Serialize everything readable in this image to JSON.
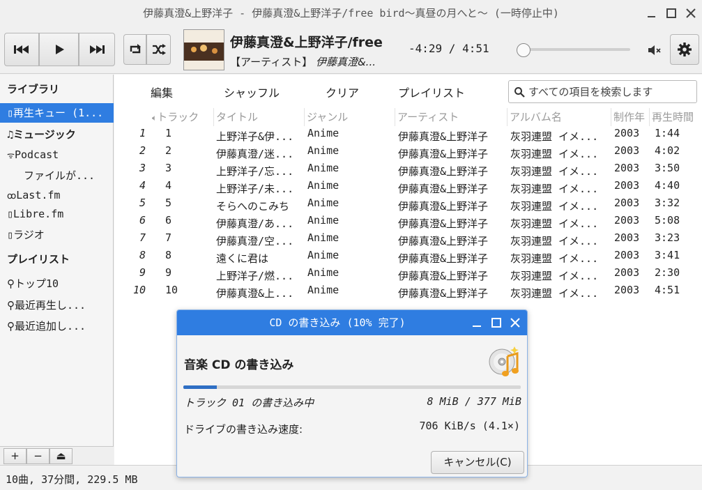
{
  "window": {
    "title": "伊藤真澄&上野洋子 - 伊藤真澄&上野洋子/free bird〜真昼の月へと〜 (一時停止中)"
  },
  "now_playing": {
    "title": "伊藤真澄&上野洋子/free",
    "artist_label": "【アーティスト】",
    "artist": "伊藤真澄&...",
    "time": "-4:29 / 4:51",
    "position_fraction": 0.0
  },
  "menu": {
    "edit": "編集",
    "shuffle": "シャッフル",
    "clear": "クリア",
    "playlist": "プレイリスト"
  },
  "search": {
    "placeholder": "すべての項目を検索します"
  },
  "sidebar": {
    "library_header": "ライブラリ",
    "items": [
      {
        "label": "再生キュー (1..."
      },
      {
        "label": "ミュージック"
      },
      {
        "label": "Podcast"
      },
      {
        "label": "ファイルが..."
      },
      {
        "label": "Last.fm"
      },
      {
        "label": "Libre.fm"
      },
      {
        "label": "ラジオ"
      }
    ],
    "playlist_header": "プレイリスト",
    "playlists": [
      {
        "label": "トップ10"
      },
      {
        "label": "最近再生し..."
      },
      {
        "label": "最近追加し..."
      }
    ],
    "add": "+",
    "remove": "−",
    "eject": "⏏"
  },
  "columns": {
    "track": "トラック",
    "title": "タイトル",
    "genre": "ジャンル",
    "artist": "アーティスト",
    "album": "アルバム名",
    "year": "制作年",
    "duration": "再生時間"
  },
  "tracks": [
    {
      "idx": "1",
      "track": "1",
      "title": "上野洋子&伊...",
      "genre": "Anime",
      "artist": "伊藤真澄&上野洋子",
      "album": "灰羽連盟 イメ...",
      "year": "2003",
      "duration": "1:44"
    },
    {
      "idx": "2",
      "track": "2",
      "title": "伊藤真澄/迷...",
      "genre": "Anime",
      "artist": "伊藤真澄&上野洋子",
      "album": "灰羽連盟 イメ...",
      "year": "2003",
      "duration": "4:02"
    },
    {
      "idx": "3",
      "track": "3",
      "title": "上野洋子/忘...",
      "genre": "Anime",
      "artist": "伊藤真澄&上野洋子",
      "album": "灰羽連盟 イメ...",
      "year": "2003",
      "duration": "3:50"
    },
    {
      "idx": "4",
      "track": "4",
      "title": "上野洋子/未...",
      "genre": "Anime",
      "artist": "伊藤真澄&上野洋子",
      "album": "灰羽連盟 イメ...",
      "year": "2003",
      "duration": "4:40"
    },
    {
      "idx": "5",
      "track": "5",
      "title": "そらへのこみち",
      "genre": "Anime",
      "artist": "伊藤真澄&上野洋子",
      "album": "灰羽連盟 イメ...",
      "year": "2003",
      "duration": "3:32"
    },
    {
      "idx": "6",
      "track": "6",
      "title": "伊藤真澄/あ...",
      "genre": "Anime",
      "artist": "伊藤真澄&上野洋子",
      "album": "灰羽連盟 イメ...",
      "year": "2003",
      "duration": "5:08"
    },
    {
      "idx": "7",
      "track": "7",
      "title": "伊藤真澄/空...",
      "genre": "Anime",
      "artist": "伊藤真澄&上野洋子",
      "album": "灰羽連盟 イメ...",
      "year": "2003",
      "duration": "3:23"
    },
    {
      "idx": "8",
      "track": "8",
      "title": "遠くに君は",
      "genre": "Anime",
      "artist": "伊藤真澄&上野洋子",
      "album": "灰羽連盟 イメ...",
      "year": "2003",
      "duration": "3:41"
    },
    {
      "idx": "9",
      "track": "9",
      "title": "上野洋子/燃...",
      "genre": "Anime",
      "artist": "伊藤真澄&上野洋子",
      "album": "灰羽連盟 イメ...",
      "year": "2003",
      "duration": "2:30"
    },
    {
      "idx": "10",
      "track": "10",
      "title": "伊藤真澄&上...",
      "genre": "Anime",
      "artist": "伊藤真澄&上野洋子",
      "album": "灰羽連盟 イメ...",
      "year": "2003",
      "duration": "4:51"
    }
  ],
  "status": {
    "summary": "10曲, 37分間, 229.5 MB"
  },
  "dialog": {
    "title": "CD の書き込み (10% 完了)",
    "heading": "音楽 CD の書き込み",
    "progress_fraction": 0.1,
    "status_text": "トラック 01 の書き込み中",
    "size_text": "8 MiB / 377 MiB",
    "speed_label": "ドライブの書き込み速度:",
    "speed_value": "706 KiB/s (4.1×)",
    "cancel_label": "キャンセル(C)"
  },
  "colors": {
    "accent": "#2f7de1",
    "progress": "#2f6fc4"
  }
}
